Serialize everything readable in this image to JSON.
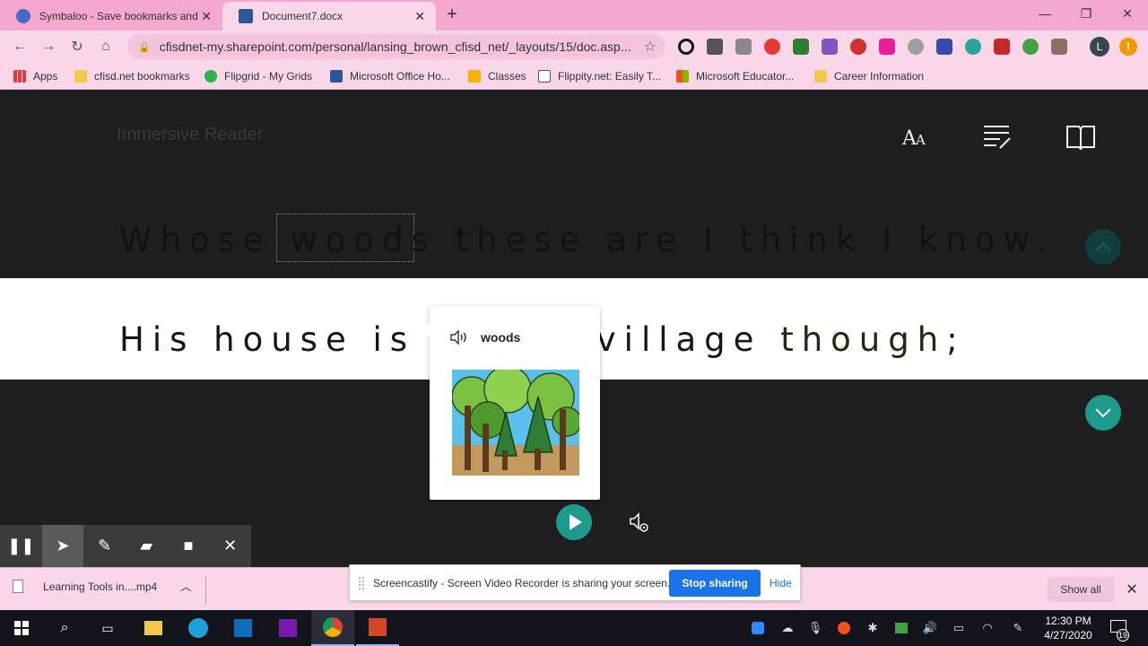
{
  "browser": {
    "tabs": [
      {
        "title": "Symbaloo - Save bookmarks and",
        "active": false
      },
      {
        "title": "Document7.docx",
        "active": true
      }
    ],
    "new_tab": "+",
    "url": "cfisdnet-my.sharepoint.com/personal/lansing_brown_cfisd_net/_layouts/15/doc.asp...",
    "profile_initial": "L",
    "bookmarks": [
      {
        "label": "Apps",
        "icon": "apps-grid-icon"
      },
      {
        "label": "cfisd.net bookmarks",
        "icon": "folder-icon"
      },
      {
        "label": "Flipgrid - My Grids",
        "icon": "flipgrid-icon"
      },
      {
        "label": "Microsoft Office Ho...",
        "icon": "word-icon"
      },
      {
        "label": "Classes",
        "icon": "classroom-icon"
      },
      {
        "label": "Flippity.net: Easily T...",
        "icon": "flippity-icon"
      },
      {
        "label": "Microsoft Educator...",
        "icon": "microsoft-icon"
      },
      {
        "label": "Career Information",
        "icon": "folder-icon"
      }
    ]
  },
  "reader": {
    "title": "Immersive Reader",
    "line1_before": "Whose ",
    "line1_word": "woods",
    "line1_after": " these are I think I know.",
    "line2_a": "His house is in the village ",
    "line2_b": "though",
    "line2_c": ";",
    "popup": {
      "word": "woods",
      "picture": "trees-picture"
    }
  },
  "screencastify": {
    "tools": [
      "pause-icon",
      "cursor-icon",
      "pen-icon",
      "eraser-icon",
      "camera-icon",
      "close-icon"
    ],
    "share_message": "Screencastify - Screen Video Recorder is sharing your screen.",
    "stop_label": "Stop sharing",
    "hide_label": "Hide"
  },
  "downloads": {
    "file": "Learning Tools in....mp4",
    "show_all": "Show all"
  },
  "taskbar": {
    "time": "12:30 PM",
    "date": "4/27/2020",
    "notification_count": "19"
  },
  "colors": {
    "accent_teal": "#1c9a8c",
    "chrome_pink": "#f4a8cf",
    "link_blue": "#1a73e8"
  }
}
